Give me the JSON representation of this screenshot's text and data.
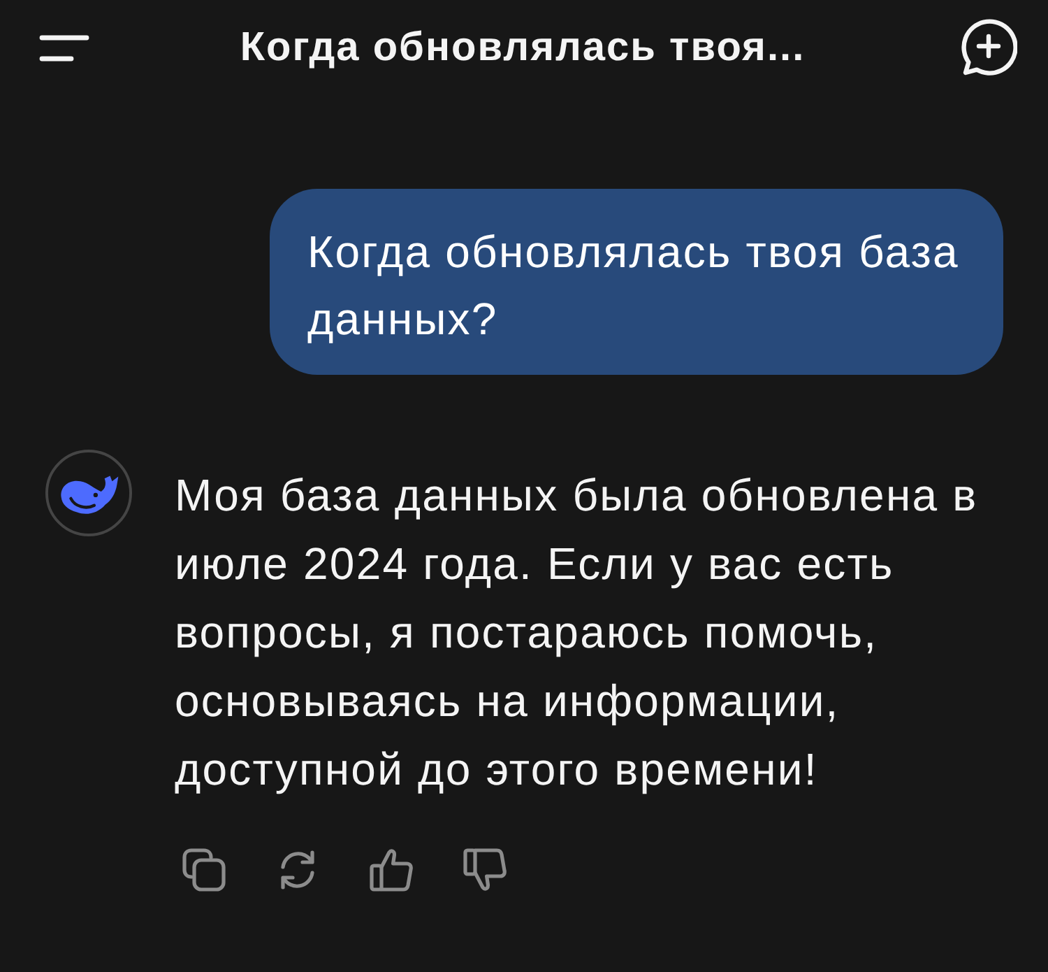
{
  "header": {
    "title": "Когда обновлялась твоя..."
  },
  "messages": [
    {
      "kind": "user",
      "text": "Когда обновлялась твоя база данных?"
    },
    {
      "kind": "assistant",
      "text": "Моя база данных была обновлена в июле 2024 года. Если у вас есть вопросы, я постараюсь помочь, основываясь на информации, доступной до этого времени!"
    }
  ]
}
